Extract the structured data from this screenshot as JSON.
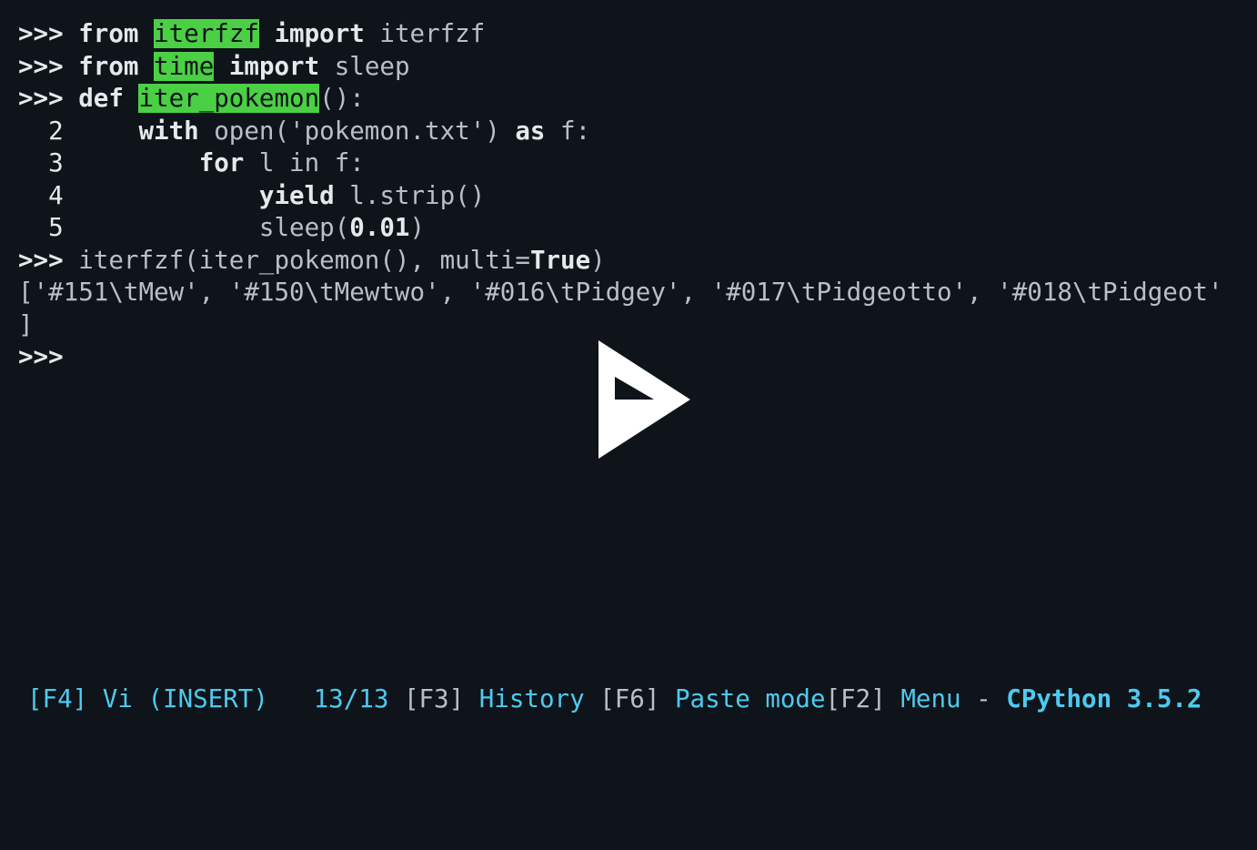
{
  "code": {
    "l1": {
      "prompt": ">>> ",
      "kw1": "from",
      "sp1": " ",
      "hl": "iterfzf",
      "sp2": " ",
      "kw2": "import",
      "rest": " iterfzf"
    },
    "l2": {
      "prompt": ">>> ",
      "kw1": "from",
      "sp1": " ",
      "hl": "time",
      "sp2": " ",
      "kw2": "import",
      "rest": " sleep"
    },
    "l3": {
      "prompt": ">>> ",
      "kw1": "def",
      "sp1": " ",
      "hl": "iter_pokemon",
      "rest": "():"
    },
    "l4": {
      "gutter": "  2     ",
      "kw1": "with",
      "mid": " open('pokemon.txt') ",
      "kw2": "as",
      "rest": " f:"
    },
    "l5": {
      "gutter": "  3         ",
      "kw1": "for",
      "rest": " l in f:"
    },
    "l6": {
      "gutter": "  4             ",
      "kw1": "yield",
      "rest": " l.strip()"
    },
    "l7": {
      "gutter": "  5             ",
      "pre": "sleep(",
      "num": "0.01",
      "post": ")"
    },
    "l8": {
      "prompt": ">>> ",
      "pre": "iterfzf(iter_pokemon(), multi=",
      "kw1": "True",
      "post": ")"
    },
    "l9": "['#151\\tMew', '#150\\tMewtwo', '#016\\tPidgey', '#017\\tPidgeotto', '#018\\tPidgeot'",
    "l10": "]",
    "l11": ">>> "
  },
  "status": {
    "f4_key": "[F4]",
    "f4_label": " Vi (INSERT)",
    "gap1": "   ",
    "counter": "13/13 ",
    "f3_key": "[F3]",
    "f3_label": " History ",
    "f6_key": "[F6]",
    "f6_label": " Paste mode",
    "f2_key": "[F2]",
    "f2_label": " Menu ",
    "dash": "- ",
    "impl": "CPython 3.5.2"
  }
}
